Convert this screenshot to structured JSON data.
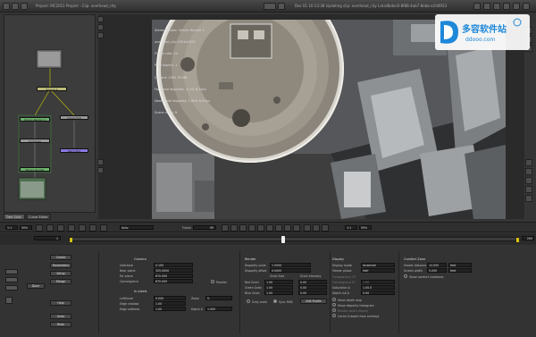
{
  "app": {
    "title": "Project: MC2011 Project - Clip: overhead_city",
    "path": "Dec 01 10:13:38 Updating clip: overhead_city  Ldcx8b4ec0-8f88-4ab7-8ebb-a1fd6f23"
  },
  "watermark": {
    "brand": "多容软件站",
    "url": "ddooo.com"
  },
  "overlay": {
    "lines": [
      "Stereo Render: Stereo Render 1",
      "overhead_city 1024x1024",
      "Frame rate: 24",
      "Pixel aspect: 1",
      "Current: 1920 33 MB",
      "Far plane disparity: -0.1% 6.14px",
      "Near plane disparity: 1.69% 6.50px",
      "Scene units: ft"
    ]
  },
  "node_graph": {
    "nodes": [
      "Source 1",
      "Stereo Render 1",
      "Adjust Edit",
      "Compose",
      "Warp Edit",
      "Stereo Render"
    ]
  },
  "bottom_tabs": [
    "Tree View",
    "Curve Editor"
  ],
  "transport": {
    "frame_label": "Frame",
    "frame_value": "95",
    "zoom_a": "1:1",
    "zoom_b": "50%",
    "zoom_c": "1:1",
    "zoom_d": "50%",
    "auto": "Auto"
  },
  "timeline": {
    "start": "1",
    "end": "200",
    "current": "95"
  },
  "left_buttons": [
    "Create",
    "Parameters",
    "Setup",
    "Merge",
    "Done",
    "Help",
    "Undo",
    "Redo"
  ],
  "camera": {
    "header": "Camera",
    "rows": [
      {
        "label": "Interaxial",
        "value": "0.100"
      },
      {
        "label": "Near plane",
        "value": "325.0000"
      },
      {
        "label": "Far plane",
        "value": "670.000"
      },
      {
        "label": "Convergence",
        "value": "670.000"
      }
    ],
    "parallel_label": "Parallel",
    "inspect_header": "In pixels",
    "px_rows": [
      {
        "label": "Left/Inset",
        "value": "0.000"
      },
      {
        "label": "Edge shadow",
        "value": "1.00"
      },
      {
        "label": "Edge softness",
        "value": "1.00"
      }
    ],
    "zoom_label": "Zoom",
    "zoom_value": "0.",
    "depth_label": "Depth A",
    "depth_value": "1.000"
  },
  "render": {
    "header": "Render",
    "rows": [
      {
        "label": "Disparity scale",
        "value": "1.0000"
      },
      {
        "label": "Disparity offset",
        "value": "0.0000"
      }
    ],
    "grain_header": "Grain Size",
    "grain_header2": "Grain intensity",
    "grain_rows": [
      {
        "label": "Red Grain",
        "v1": "1.00",
        "v2": "0.00"
      },
      {
        "label": "Green Grain",
        "v1": "1.00",
        "v2": "0.00"
      },
      {
        "label": "Blue Grain",
        "v1": "1.00",
        "v2": "0.00"
      }
    ],
    "gray_label": "Grey scale",
    "sync_label": "Sync RGB",
    "edit_label": "Edit Profile"
  },
  "display": {
    "header": "Display",
    "rows": [
      {
        "label": "Display mode",
        "value": "Anaglyph"
      },
      {
        "label": "Viewer phase",
        "value": "Half"
      },
      {
        "label": "Transparency ST",
        "value": ""
      },
      {
        "label": "Convergence ST",
        "value": "1.00"
      },
      {
        "label": "Saturation A",
        "value": "1.00.0"
      },
      {
        "label": "Depth cut A",
        "value": "0.00"
      }
    ],
    "checks": [
      "Show depth map",
      "Show disparity histogram",
      "Render depth display",
      "Cache Z-depth from overlays"
    ]
  },
  "comfort": {
    "header": "Comfort Zone",
    "rows": [
      {
        "label": "Viewer distance",
        "value": "14.000",
        "unit": "feet"
      },
      {
        "label": "Screen width",
        "value": "5.000",
        "unit": "feet"
      }
    ],
    "check_label": "Show comfort violations"
  }
}
